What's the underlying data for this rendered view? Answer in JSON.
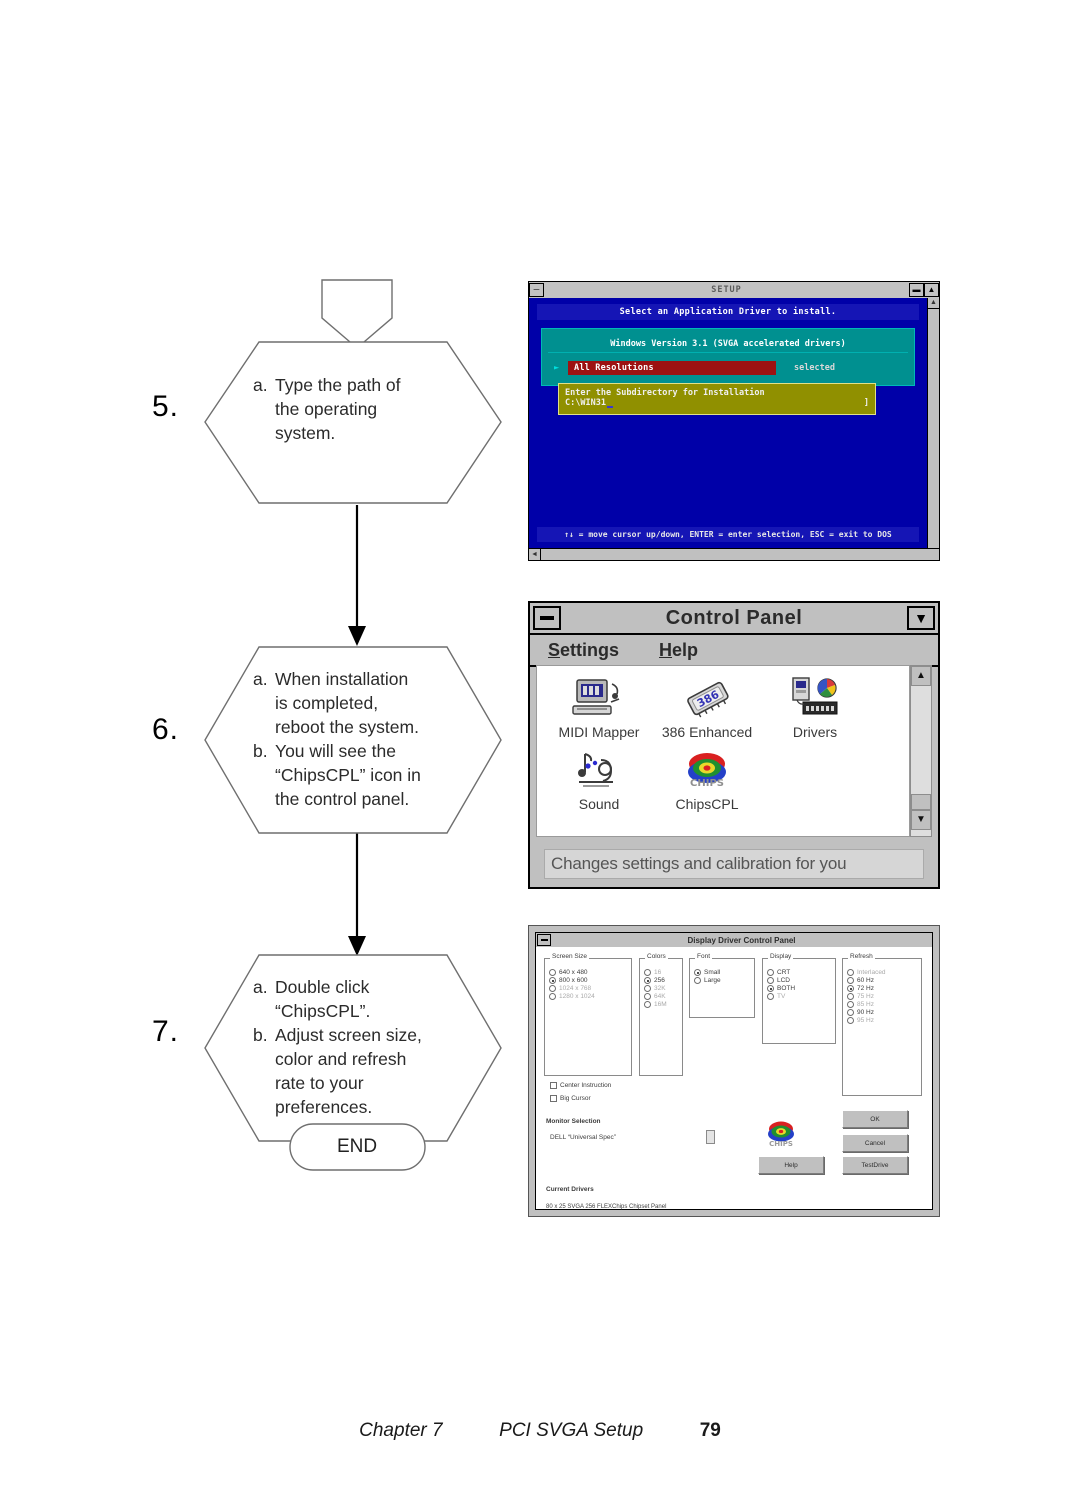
{
  "flowchart": {
    "steps": [
      {
        "number": "5.",
        "lines": [
          {
            "label": "a.",
            "text": "Type the path of"
          },
          {
            "label": "",
            "text": "the operating"
          },
          {
            "label": "",
            "text": "system."
          }
        ]
      },
      {
        "number": "6.",
        "lines": [
          {
            "label": "a.",
            "text": "When installation"
          },
          {
            "label": "",
            "text": "is completed,"
          },
          {
            "label": "",
            "text": "reboot the system."
          },
          {
            "label": "b.",
            "text": "You will see the"
          },
          {
            "label": "",
            "text": "“ChipsCPL” icon in"
          },
          {
            "label": "",
            "text": "the control panel."
          }
        ]
      },
      {
        "number": "7.",
        "lines": [
          {
            "label": "a.",
            "text": "Double click"
          },
          {
            "label": "",
            "text": "“ChipsCPL”."
          },
          {
            "label": "b.",
            "text": "Adjust screen size,"
          },
          {
            "label": "",
            "text": "color and refresh"
          },
          {
            "label": "",
            "text": "rate to your"
          },
          {
            "label": "",
            "text": "preferences."
          }
        ]
      }
    ],
    "terminator_label": "END"
  },
  "dos_setup": {
    "title": "SETUP",
    "minimize_glyph": "─",
    "restore_glyph": "▬",
    "maximize_glyph": "▲",
    "header": "Select an Application Driver to install.",
    "panel_title": "Windows Version 3.1 (SVGA accelerated drivers)",
    "selection_arrow": "►",
    "selection_item": "All Resolutions",
    "selection_state": "selected",
    "prompt_line1": "Enter the Subdirectory for Installation",
    "prompt_path": "C:\\WIN31",
    "prompt_marker": "]",
    "footer": "↑↓ = move cursor up/down,  ENTER = enter selection,  ESC = exit to DOS",
    "scroll_up_glyph": "▲",
    "scroll_down_glyph": "▼",
    "scroll_left_glyph": "◄",
    "scroll_right_glyph": "►",
    "colors": {
      "desktop": "#0000a8",
      "header_bar": "#1515b5",
      "panel": "#009090",
      "selection": "#9c1212",
      "prompt": "#909000"
    }
  },
  "control_panel": {
    "title": "Control Panel",
    "maximize_glyph": "▼",
    "menus": [
      {
        "pre": "S",
        "rest": "ettings"
      },
      {
        "pre": "H",
        "rest": "elp"
      }
    ],
    "icons": [
      {
        "name": "MIDI Mapper",
        "icon": "midi-mapper-icon"
      },
      {
        "name": "386 Enhanced",
        "icon": "386-enhanced-icon"
      },
      {
        "name": "Drivers",
        "icon": "drivers-icon"
      },
      {
        "name": "Sound",
        "icon": "sound-icon"
      },
      {
        "name": "ChipsCPL",
        "icon": "chipscpl-icon"
      }
    ],
    "status_text": "Changes settings and calibration for you",
    "scroll_up_glyph": "▲",
    "scroll_down_glyph": "▼"
  },
  "display_panel": {
    "title": "Display Driver Control Panel",
    "groups": {
      "screen_size": {
        "title": "Screen Size",
        "options": [
          {
            "label": "640 x 480",
            "selected": false
          },
          {
            "label": "800 x 600",
            "selected": true
          },
          {
            "label": "1024 x 768",
            "selected": false,
            "dim": true
          },
          {
            "label": "1280 x 1024",
            "selected": false,
            "dim": true
          }
        ]
      },
      "colors": {
        "title": "Colors",
        "options": [
          {
            "label": "16",
            "selected": false,
            "dim": true
          },
          {
            "label": "256",
            "selected": true
          },
          {
            "label": "32K",
            "selected": false,
            "dim": true
          },
          {
            "label": "64K",
            "selected": false,
            "dim": true
          },
          {
            "label": "16M",
            "selected": false,
            "dim": true
          }
        ]
      },
      "font": {
        "title": "Font",
        "options": [
          {
            "label": "Small",
            "selected": true
          },
          {
            "label": "Large",
            "selected": false
          }
        ]
      },
      "display": {
        "title": "Display",
        "options": [
          {
            "label": "CRT",
            "selected": false
          },
          {
            "label": "LCD",
            "selected": false
          },
          {
            "label": "BOTH",
            "selected": true
          },
          {
            "label": "TV",
            "selected": false,
            "dim": true
          }
        ]
      },
      "refresh": {
        "title": "Refresh",
        "options": [
          {
            "label": "Interlaced",
            "selected": false,
            "dim": true
          },
          {
            "label": "60 Hz",
            "selected": false
          },
          {
            "label": "72 Hz",
            "selected": true
          },
          {
            "label": "75 Hz",
            "selected": false,
            "dim": true
          },
          {
            "label": "85 Hz",
            "selected": false,
            "dim": true
          },
          {
            "label": "90 Hz",
            "selected": false
          },
          {
            "label": "95 Hz",
            "selected": false,
            "dim": true
          }
        ]
      }
    },
    "checkboxes": [
      {
        "label": "Center Instruction",
        "checked": false
      },
      {
        "label": "Big Cursor",
        "checked": false
      }
    ],
    "monitor_label": "Monitor Selection",
    "monitor_value": "DELL “Universal Spec”",
    "current_drivers_label": "Current Drivers",
    "current_drivers_value": "80 x 25 SVGA 256 FLEXChips Chipset Panel",
    "buttons": [
      {
        "label": "OK",
        "name": "ok-button"
      },
      {
        "label": "Cancel",
        "name": "cancel-button"
      },
      {
        "label": "Help",
        "name": "help-button"
      },
      {
        "label": "TestDrive",
        "name": "testdrive-button"
      }
    ],
    "chips_logo_caption": "CHIPS"
  },
  "footer": {
    "chapter": "Chapter 7",
    "section": "PCI SVGA Setup",
    "page": "79"
  }
}
